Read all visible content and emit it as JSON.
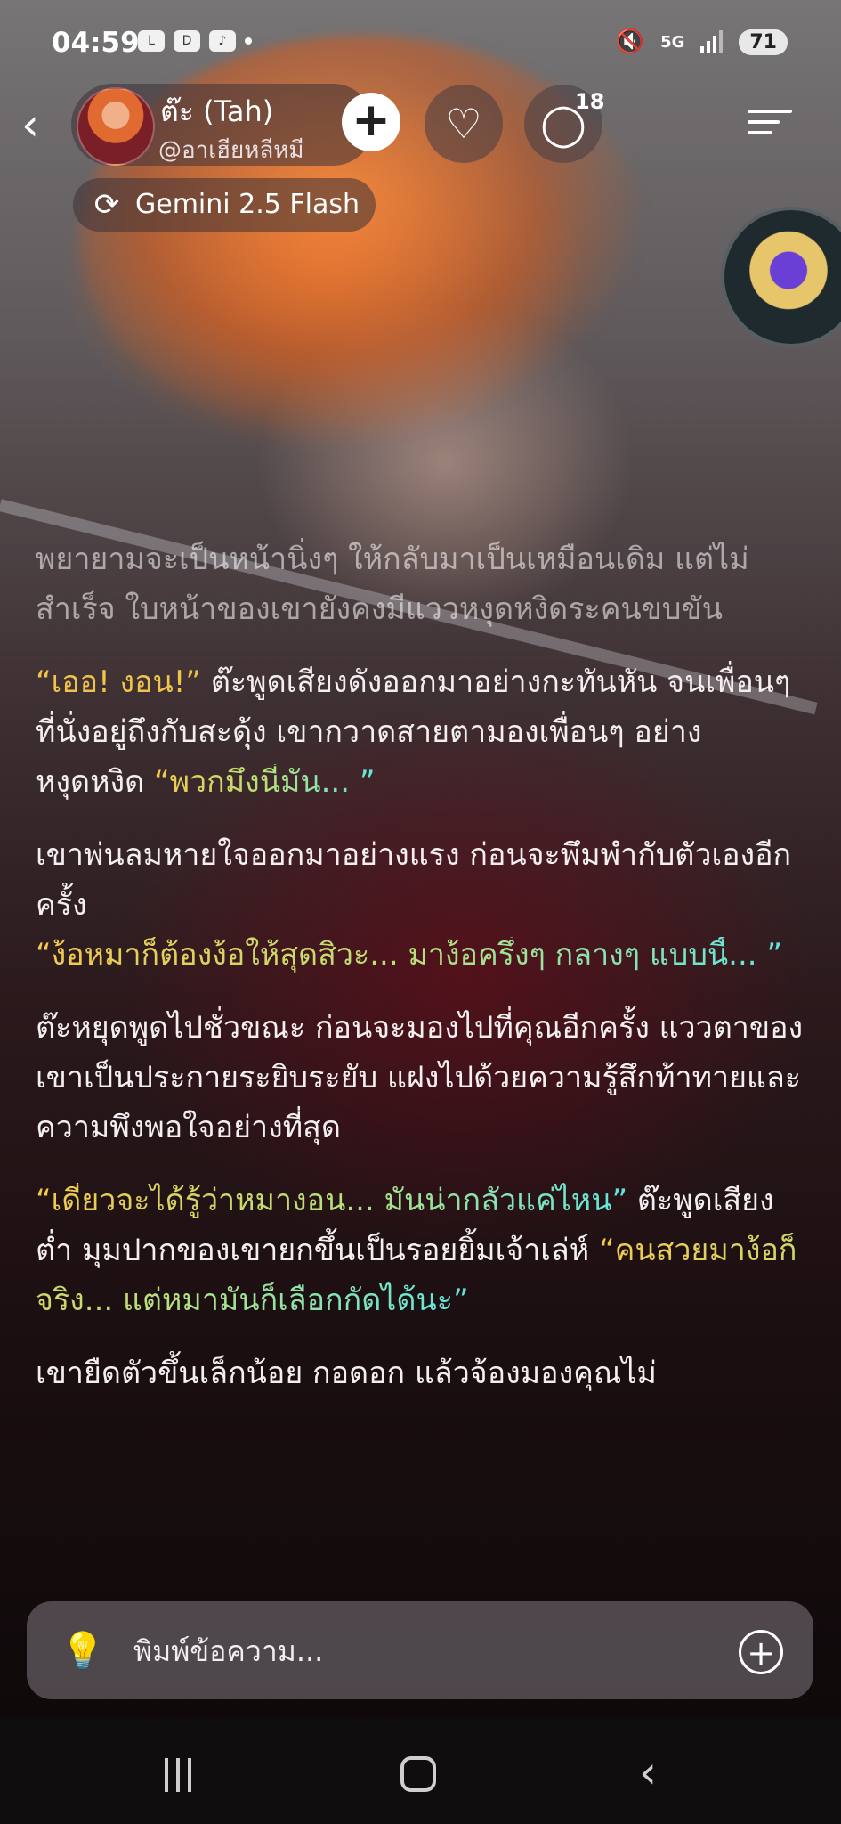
{
  "status_bar": {
    "time": "04:59",
    "network": "5G",
    "battery": "71"
  },
  "header": {
    "back_icon": "chevron-left-icon",
    "character_name": "ต๊ะ (Tah)",
    "creator_handle": "@อาเฮียหลีหมี",
    "model_name": "Gemini 2.5 Flash",
    "comment_count": "18"
  },
  "chat": {
    "paragraphs": {
      "p1": "พยายามจะเป็นหน้านิ่งๆ ให้กลับมาเป็นเหมือนเดิม แต่ไม่สำเร็จ ใบหน้าของเขายังคงมีแววหงุดหงิดระคนขบขัน",
      "p2_speech": "“เออ! งอน!”",
      "p2_text": " ต๊ะพูดเสียงดังออกมาอย่างกะทันหัน จนเพื่อนๆ ที่นั่งอยู่ถึงกับสะดุ้ง เขากวาดสายตามองเพื่อนๆ อย่างหงุดหงิด ",
      "p2_speech2": "“พวกมึงนี่มัน... ”",
      "p3_text": "เขาพ่นลมหายใจออกมาอย่างแรง ก่อนจะพึมพำกับตัวเองอีกครั้ง",
      "p3_speech": "“ง้อหมาก็ต้องง้อให้สุดสิวะ... มาง้อครึ่งๆ กลางๆ แบบนี้... ”",
      "p4_text": "ต๊ะหยุดพูดไปชั่วขณะ ก่อนจะมองไปที่คุณอีกครั้ง แววตาของเขาเป็นประกายระยิบระยับ แฝงไปด้วยความรู้สึกท้าทายและความพึงพอใจอย่างที่สุด",
      "p5_speech": "“เดี๋ยวจะได้รู้ว่าหมางอน... มันน่ากลัวแค่ไหน”",
      "p5_text": " ต๊ะพูดเสียงต่ำ มุมปากของเขายกขึ้นเป็นรอยยิ้มเจ้าเล่ห์ ",
      "p5_speech2": "“คนสวยมาง้อก็จริง... แต่หมามันก็เลือกกัดได้นะ”",
      "p6_text": "เขายืดตัวขึ้นเล็กน้อย กอดอก แล้วจ้องมองคุณไม่"
    }
  },
  "input": {
    "placeholder": "พิมพ์ข้อความ..."
  },
  "colors": {
    "speech_start": "#f5c94c",
    "speech_end": "#5fe6e0"
  }
}
